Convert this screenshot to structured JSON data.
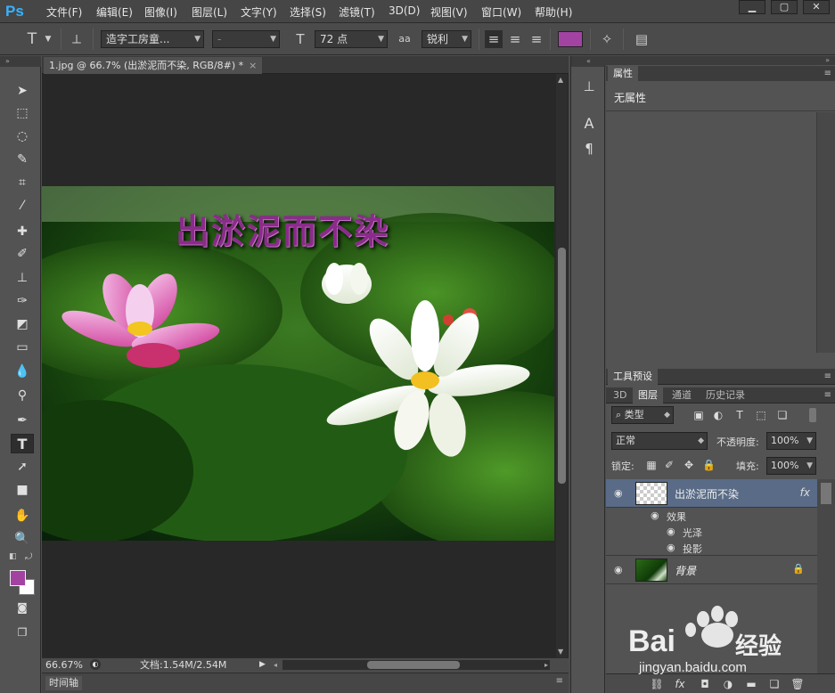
{
  "app": {
    "logo": "Ps",
    "brand_color": "#38b2ff"
  },
  "menu": [
    "文件(F)",
    "编辑(E)",
    "图像(I)",
    "图层(L)",
    "文字(Y)",
    "选择(S)",
    "滤镜(T)",
    "3D(D)",
    "视图(V)",
    "窗口(W)",
    "帮助(H)"
  ],
  "window_controls": {
    "minimize": "▁",
    "restore": "▢",
    "close": "✕"
  },
  "options": {
    "tool_icon": "T",
    "font_family": "造字工房童...",
    "font_style": "-",
    "font_size": "72 点",
    "aa_label": "aa",
    "antialias": "锐利",
    "text_color": "#a243a2"
  },
  "document": {
    "tab_title": "1.jpg @ 66.7% (出淤泥而不染, RGB/8#) *",
    "canvas_text": "出淤泥而不染",
    "canvas_text_color": "#8a2c8a"
  },
  "status": {
    "zoom": "66.67%",
    "doc_size": "文档:1.54M/2.54M"
  },
  "timeline": {
    "label": "时间轴"
  },
  "tools": {
    "fg_color": "#a243a2",
    "bg_color": "#ffffff"
  },
  "properties": {
    "tab": "属性",
    "body": "无属性"
  },
  "tool_presets": {
    "tab": "工具预设"
  },
  "layers_panel": {
    "tabs": [
      "3D",
      "图层",
      "通道",
      "历史记录"
    ],
    "filter_label": "类型",
    "blend_mode": "正常",
    "opacity_label": "不透明度:",
    "opacity_value": "100%",
    "lock_label": "锁定:",
    "fill_label": "填充:",
    "fill_value": "100%",
    "layers": [
      {
        "name": "出淤泥而不染",
        "fx": "fx"
      },
      {
        "name": "背景"
      }
    ],
    "effects_label": "效果",
    "effects": [
      "光泽",
      "投影"
    ]
  },
  "watermark": {
    "brand": "Bai",
    "brand2": "经验",
    "url": "jingyan.baidu.com"
  }
}
